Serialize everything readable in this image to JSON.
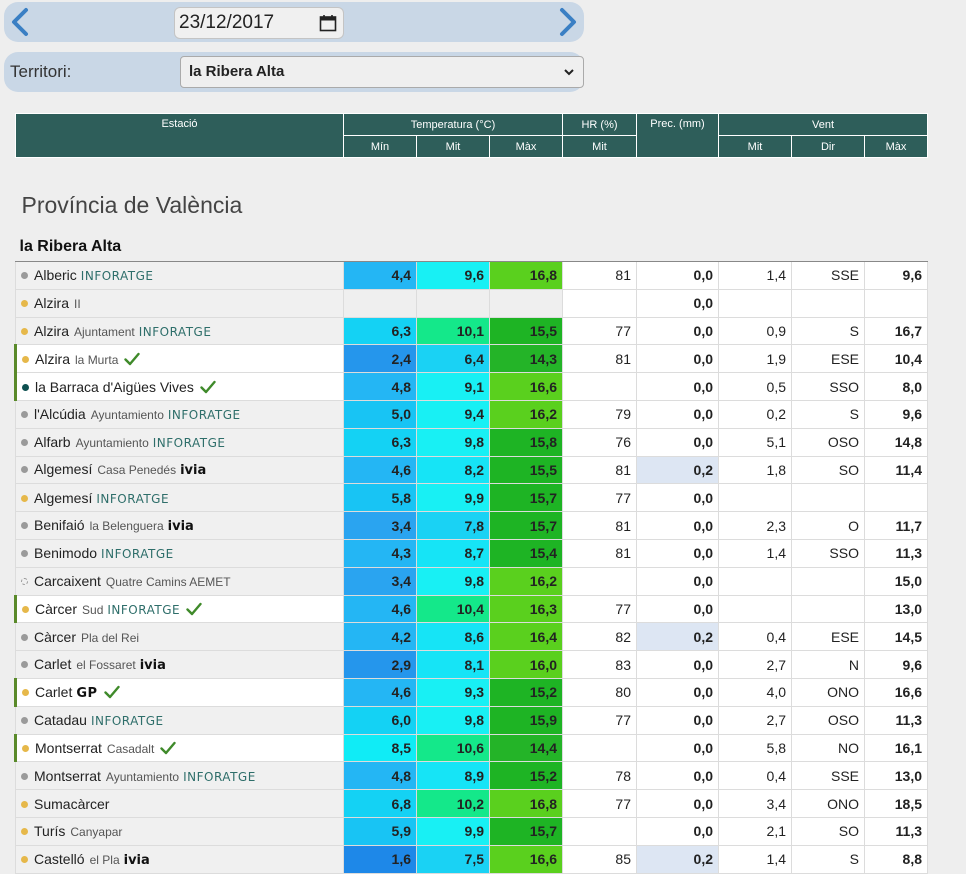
{
  "date": {
    "value": "23/12/2017"
  },
  "territori": {
    "label": "Territori:",
    "selected": "la Ribera Alta"
  },
  "table": {
    "headers": {
      "station": "Estació",
      "temperature": "Temperatura (°C)",
      "hr": "HR (%)",
      "prec": "Prec. (mm)",
      "wind": "Vent",
      "min": "Mín",
      "mit": "Mit",
      "max": "Màx",
      "hr_mit": "Mit",
      "wind_mit": "Mit",
      "wind_dir": "Dir",
      "wind_max": "Màx"
    },
    "province": "Província de València",
    "region": "la Ribera Alta",
    "rows": [
      {
        "name": "Alberic",
        "sub": "",
        "net": "INFORATGE",
        "dot": "grey",
        "check": false,
        "tmin": "4,4",
        "tmit": "9,6",
        "tmax": "16,8",
        "hr": "81",
        "prec": "0,0",
        "wmit": "1,4",
        "wdir": "SSE",
        "wmax": "9,6"
      },
      {
        "name": "Alzira",
        "sub": "II",
        "net": "",
        "dot": "yellow",
        "check": false,
        "tmin": "",
        "tmit": "",
        "tmax": "",
        "hr": "",
        "prec": "0,0",
        "wmit": "",
        "wdir": "",
        "wmax": ""
      },
      {
        "name": "Alzira",
        "sub": "Ajuntament",
        "net": "INFORATGE",
        "dot": "yellow",
        "check": false,
        "tmin": "6,3",
        "tmit": "10,1",
        "tmax": "15,5",
        "hr": "77",
        "prec": "0,0",
        "wmit": "0,9",
        "wdir": "S",
        "wmax": "16,7"
      },
      {
        "name": "Alzira",
        "sub": "la Murta",
        "net": "",
        "dot": "yellow",
        "check": true,
        "tmin": "2,4",
        "tmit": "6,4",
        "tmax": "14,3",
        "hr": "81",
        "prec": "0,0",
        "wmit": "1,9",
        "wdir": "ESE",
        "wmax": "10,4"
      },
      {
        "name": "la Barraca d'Aigües Vives",
        "sub": "",
        "net": "",
        "dot": "teal",
        "check": true,
        "tmin": "4,8",
        "tmit": "9,1",
        "tmax": "16,6",
        "hr": "",
        "prec": "0,0",
        "wmit": "0,5",
        "wdir": "SSO",
        "wmax": "8,0"
      },
      {
        "name": "l'Alcúdia",
        "sub": "Ayuntamiento",
        "net": "INFORATGE",
        "dot": "grey",
        "check": false,
        "tmin": "5,0",
        "tmit": "9,4",
        "tmax": "16,2",
        "hr": "79",
        "prec": "0,0",
        "wmit": "0,2",
        "wdir": "S",
        "wmax": "9,6"
      },
      {
        "name": "Alfarb",
        "sub": "Ayuntamiento",
        "net": "INFORATGE",
        "dot": "grey",
        "check": false,
        "tmin": "6,3",
        "tmit": "9,8",
        "tmax": "15,8",
        "hr": "76",
        "prec": "0,0",
        "wmit": "5,1",
        "wdir": "OSO",
        "wmax": "14,8"
      },
      {
        "name": "Algemesí",
        "sub": "Casa Penedés",
        "net": "ivia",
        "dot": "grey",
        "check": false,
        "tmin": "4,6",
        "tmit": "8,2",
        "tmax": "15,5",
        "hr": "81",
        "prec": "0,2",
        "wmit": "1,8",
        "wdir": "SO",
        "wmax": "11,4"
      },
      {
        "name": "Algemesí",
        "sub": "",
        "net": "INFORATGE",
        "dot": "yellow",
        "check": false,
        "tmin": "5,8",
        "tmit": "9,9",
        "tmax": "15,7",
        "hr": "77",
        "prec": "0,0",
        "wmit": "",
        "wdir": "",
        "wmax": ""
      },
      {
        "name": "Benifaió",
        "sub": "la Belenguera",
        "net": "ivia",
        "dot": "grey",
        "check": false,
        "tmin": "3,4",
        "tmit": "7,8",
        "tmax": "15,7",
        "hr": "81",
        "prec": "0,0",
        "wmit": "2,3",
        "wdir": "O",
        "wmax": "11,7"
      },
      {
        "name": "Benimodo",
        "sub": "",
        "net": "INFORATGE",
        "dot": "grey",
        "check": false,
        "tmin": "4,3",
        "tmit": "8,7",
        "tmax": "15,4",
        "hr": "81",
        "prec": "0,0",
        "wmit": "1,4",
        "wdir": "SSO",
        "wmax": "11,3"
      },
      {
        "name": "Carcaixent",
        "sub": "Quatre Camins AEMET",
        "net": "",
        "dot": "hollow",
        "check": false,
        "tmin": "3,4",
        "tmit": "9,8",
        "tmax": "16,2",
        "hr": "",
        "prec": "0,0",
        "wmit": "",
        "wdir": "",
        "wmax": "15,0"
      },
      {
        "name": "Càrcer",
        "sub": "Sud",
        "net": "INFORATGE",
        "dot": "yellow",
        "check": true,
        "tmin": "4,6",
        "tmit": "10,4",
        "tmax": "16,3",
        "hr": "77",
        "prec": "0,0",
        "wmit": "",
        "wdir": "",
        "wmax": "13,0"
      },
      {
        "name": "Càrcer",
        "sub": "Pla del Rei",
        "net": "",
        "dot": "grey",
        "check": false,
        "tmin": "4,2",
        "tmit": "8,6",
        "tmax": "16,4",
        "hr": "82",
        "prec": "0,2",
        "wmit": "0,4",
        "wdir": "ESE",
        "wmax": "14,5"
      },
      {
        "name": "Carlet",
        "sub": "el Fossaret",
        "net": "ivia",
        "dot": "grey",
        "check": false,
        "tmin": "2,9",
        "tmit": "8,1",
        "tmax": "16,0",
        "hr": "83",
        "prec": "0,0",
        "wmit": "2,7",
        "wdir": "N",
        "wmax": "9,6"
      },
      {
        "name": "Carlet",
        "sub": "",
        "net": "GP",
        "dot": "yellow",
        "check": true,
        "tmin": "4,6",
        "tmit": "9,3",
        "tmax": "15,2",
        "hr": "80",
        "prec": "0,0",
        "wmit": "4,0",
        "wdir": "ONO",
        "wmax": "16,6"
      },
      {
        "name": "Catadau",
        "sub": "",
        "net": "INFORATGE",
        "dot": "grey",
        "check": false,
        "tmin": "6,0",
        "tmit": "9,8",
        "tmax": "15,9",
        "hr": "77",
        "prec": "0,0",
        "wmit": "2,7",
        "wdir": "OSO",
        "wmax": "11,3"
      },
      {
        "name": "Montserrat",
        "sub": "Casadalt",
        "net": "",
        "dot": "yellow",
        "check": true,
        "tmin": "8,5",
        "tmit": "10,6",
        "tmax": "14,4",
        "hr": "",
        "prec": "0,0",
        "wmit": "5,8",
        "wdir": "NO",
        "wmax": "16,1"
      },
      {
        "name": "Montserrat",
        "sub": "Ayuntamiento",
        "net": "INFORATGE",
        "dot": "grey",
        "check": false,
        "tmin": "4,8",
        "tmit": "8,9",
        "tmax": "15,2",
        "hr": "78",
        "prec": "0,0",
        "wmit": "0,4",
        "wdir": "SSE",
        "wmax": "13,0"
      },
      {
        "name": "Sumacàrcer",
        "sub": "",
        "net": "",
        "dot": "yellow",
        "check": false,
        "tmin": "6,8",
        "tmit": "10,2",
        "tmax": "16,8",
        "hr": "77",
        "prec": "0,0",
        "wmit": "3,4",
        "wdir": "ONO",
        "wmax": "18,5"
      },
      {
        "name": "Turís",
        "sub": "Canyapar",
        "net": "",
        "dot": "yellow",
        "check": false,
        "tmin": "5,9",
        "tmit": "9,9",
        "tmax": "15,7",
        "hr": "",
        "prec": "0,0",
        "wmit": "2,1",
        "wdir": "SO",
        "wmax": "11,3"
      },
      {
        "name": "Castelló",
        "sub": "el Pla",
        "net": "ivia",
        "dot": "yellow",
        "check": false,
        "tmin": "1,6",
        "tmit": "7,5",
        "tmax": "16,6",
        "hr": "85",
        "prec": "0,2",
        "wmit": "1,4",
        "wdir": "S",
        "wmax": "8,8"
      }
    ]
  },
  "colors": {
    "header": "#2e5e5a",
    "panel": "#c9d7e6",
    "check": "#3f8a2a",
    "prec_rain": "#dde6f3"
  }
}
